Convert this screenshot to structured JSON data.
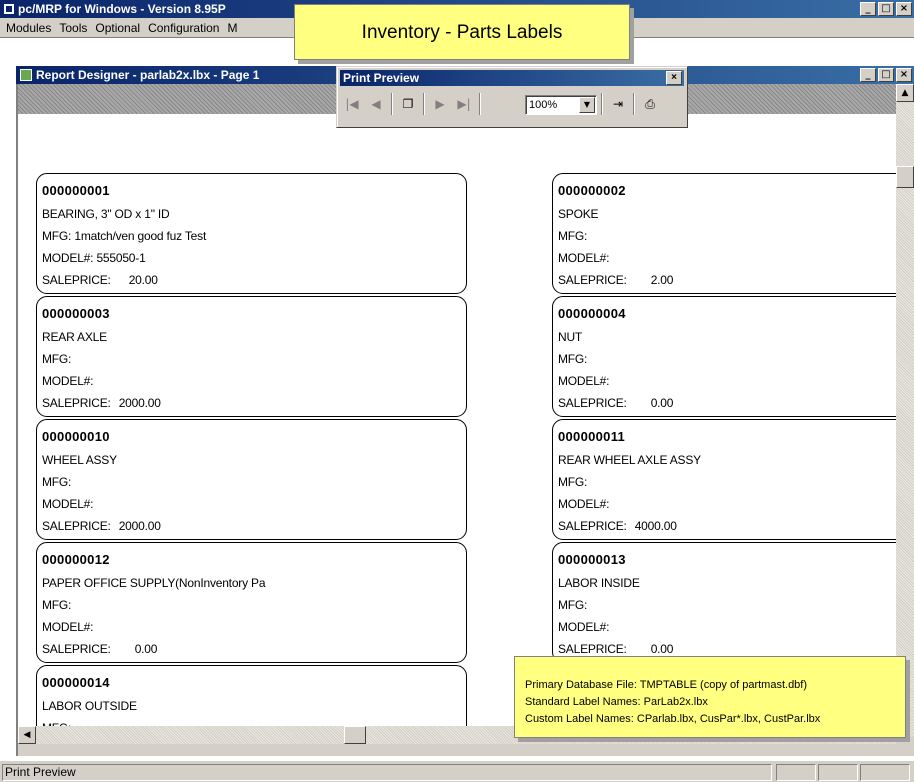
{
  "app": {
    "title": "pc/MRP for Windows - Version 8.95P",
    "menu": [
      "Modules",
      "Tools",
      "Optional",
      "Configuration",
      "M"
    ]
  },
  "doc_window": {
    "title": "Report Designer - parlab2x.lbx - Page 1"
  },
  "print_preview": {
    "title": "Print Preview",
    "zoom": "100%",
    "buttons": [
      {
        "name": "first-page-icon",
        "glyph": "|◀"
      },
      {
        "name": "prev-page-icon",
        "glyph": "◀"
      },
      {
        "name": "multi-page-icon",
        "glyph": "❐"
      },
      {
        "name": "next-page-icon",
        "glyph": "▶"
      },
      {
        "name": "last-page-icon",
        "glyph": "▶|"
      },
      {
        "name": "close-preview-icon",
        "glyph": "⇥"
      },
      {
        "name": "printer-icon",
        "glyph": "⎙"
      }
    ]
  },
  "callout_title": "Inventory - Parts Labels",
  "field_labels": {
    "mfg": "MFG:",
    "model": "MODEL#:",
    "saleprice": "SALEPRICE:"
  },
  "labels": [
    {
      "part_no": "000000001",
      "desc": "BEARING, 3\" OD x 1\" ID",
      "mfg": "1match/ven good fuz Test",
      "model": "555050-1",
      "price": "20.00"
    },
    {
      "part_no": "000000002",
      "desc": "SPOKE",
      "mfg": "",
      "model": "",
      "price": "2.00"
    },
    {
      "part_no": "000000003",
      "desc": "REAR AXLE",
      "mfg": "",
      "model": "",
      "price": "2000.00"
    },
    {
      "part_no": "000000004",
      "desc": "NUT",
      "mfg": "",
      "model": "",
      "price": "0.00"
    },
    {
      "part_no": "000000010",
      "desc": "WHEEL ASSY",
      "mfg": "",
      "model": "",
      "price": "2000.00"
    },
    {
      "part_no": "000000011",
      "desc": "REAR WHEEL AXLE ASSY",
      "mfg": "",
      "model": "",
      "price": "4000.00"
    },
    {
      "part_no": "000000012",
      "desc": "PAPER OFFICE SUPPLY(NonInventory Pa",
      "mfg": "",
      "model": "",
      "price": "0.00"
    },
    {
      "part_no": "000000013",
      "desc": "LABOR INSIDE",
      "mfg": "",
      "model": "",
      "price": "0.00"
    },
    {
      "part_no": "000000014",
      "desc": "LABOR OUTSIDE",
      "mfg": "",
      "model": "",
      "price": ""
    }
  ],
  "info_callout": {
    "lines": [
      "Primary Database File: TMPTABLE (copy of partmast.dbf)",
      "Standard Label Names: ParLab2x.lbx",
      "Custom Label Names: CParlab.lbx, CusPar*.lbx, CustPar.lbx"
    ]
  },
  "status": {
    "text": "Print Preview"
  }
}
